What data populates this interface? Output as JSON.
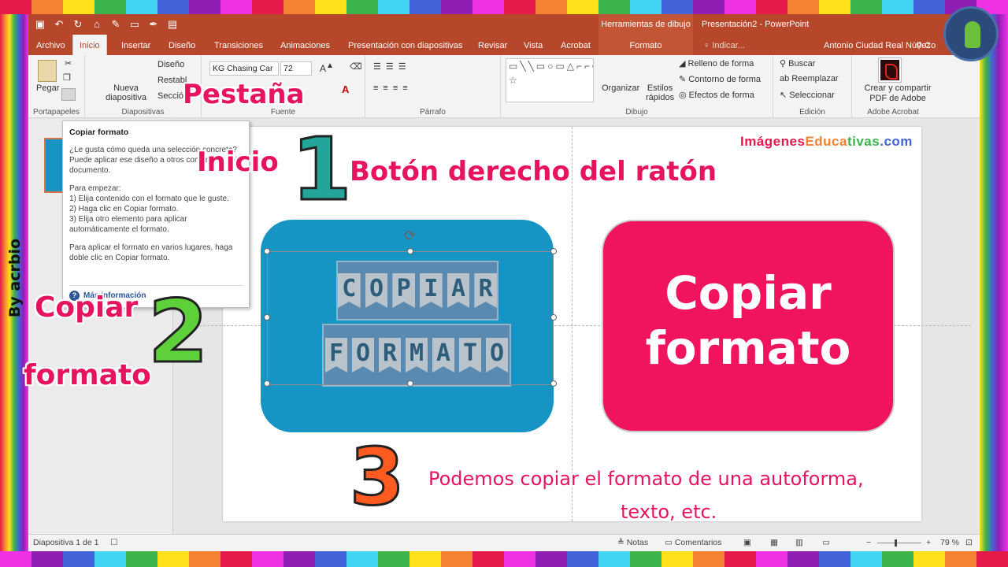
{
  "titlebar": {
    "tools_label": "Herramientas de dibujo",
    "doc_title": "Presentación2 - PowerPoint",
    "qat_icons": [
      "save-icon",
      "undo-icon",
      "redo-icon",
      "start-icon",
      "ink-icon",
      "pen-icon",
      "shape-icon",
      "format-painter-icon"
    ]
  },
  "tabs": [
    {
      "label": "Archivo"
    },
    {
      "label": "Inicio"
    },
    {
      "label": "Insertar"
    },
    {
      "label": "Diseño"
    },
    {
      "label": "Transiciones"
    },
    {
      "label": "Animaciones"
    },
    {
      "label": "Presentación con diapositivas"
    },
    {
      "label": "Revisar"
    },
    {
      "label": "Vista"
    },
    {
      "label": "Acrobat"
    },
    {
      "label": "Formato"
    }
  ],
  "tell_me": "Indicar...",
  "user_name": "Antonio Ciudad Real Núñez",
  "share_label": "Co",
  "ribbon": {
    "clipboard": {
      "paste": "Pegar",
      "label": "Portapapeles"
    },
    "slides": {
      "new": "Nueva",
      "new2": "diapositiva",
      "layout": "Diseño",
      "reset": "Restabl",
      "section": "Sección",
      "label": "Diapositivas"
    },
    "font": {
      "name": "KG Chasing Car",
      "size": "72",
      "label": "Fuente"
    },
    "paragraph": {
      "label": "Párrafo"
    },
    "drawing": {
      "arrange": "Organizar",
      "styles": "Estilos",
      "styles2": "rápidos",
      "fill": "Relleno de forma",
      "outline": "Contorno de forma",
      "effects": "Efectos de forma",
      "label": "Dibujo",
      "shapes_preview": "▭╲╲▭○▭△⌐⌐⇨⇨◯⌐╲╲{}☆"
    },
    "editing": {
      "find": "Buscar",
      "replace": "Reemplazar",
      "select": "Seleccionar",
      "label": "Edición"
    },
    "adobe": {
      "create": "Crear y compartir",
      "create2": "PDF de Adobe",
      "label": "Adobe Acrobat"
    }
  },
  "tooltip": {
    "title": "Copiar formato",
    "p1": "¿Le gusta cómo queda una selección concreta? Puede aplicar ese diseño a otros contenidos del documento.",
    "p2_intro": "Para empezar:",
    "steps": [
      "1) Elija contenido con el formato que le guste.",
      "2) Haga clic en Copiar formato.",
      "3) Elija otro elemento para aplicar automáticamente el formato."
    ],
    "p3": "Para aplicar el formato en varios lugares, haga doble clic en Copiar formato.",
    "link": "Más información"
  },
  "slide": {
    "brand_parts": [
      "Imágenes",
      "Educa",
      "tivas",
      ".com"
    ],
    "banner_row1": [
      "C",
      "O",
      "P",
      "I",
      "A",
      "R"
    ],
    "banner_row2": [
      "F",
      "O",
      "R",
      "M",
      "A",
      "T",
      "O"
    ],
    "pink_line1": "Copiar",
    "pink_line2": "formato"
  },
  "annotations": {
    "pestana": "Pestaña",
    "inicio": "Inicio",
    "num1": "1",
    "boton": "Botón derecho del ratón",
    "copiar": "Copiar",
    "formato": "formato",
    "num2": "2",
    "num3": "3",
    "podemos1": "Podemos copiar el formato de una autoforma,",
    "podemos2": "texto, etc.",
    "byline": "By acrbio"
  },
  "status": {
    "slide_count": "Diapositiva 1 de 1",
    "notes": "Notas",
    "comments": "Comentarios",
    "zoom": "79 %",
    "zoom_value": 79
  },
  "colors": {
    "accent": "#b7472a",
    "pink": "#e6145f",
    "blue_card": "#1695c5",
    "pink_card": "#f0145e"
  }
}
